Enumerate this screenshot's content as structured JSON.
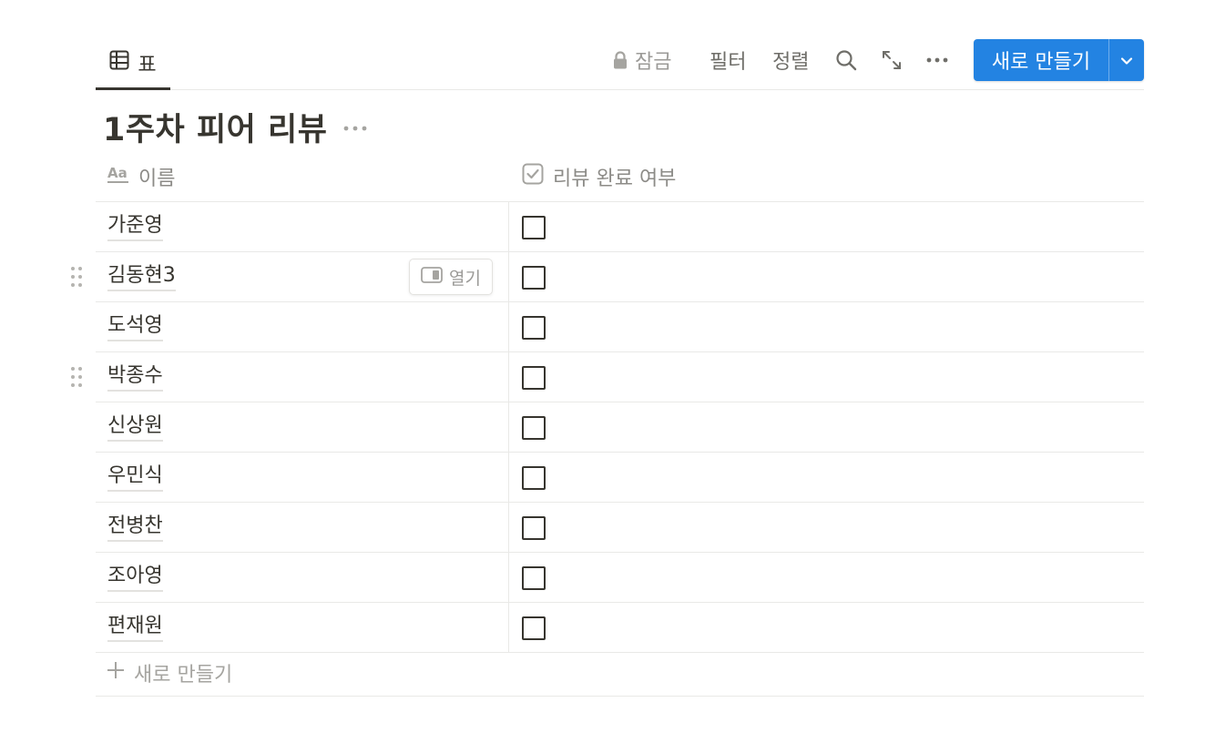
{
  "view": {
    "tab_label": "표"
  },
  "toolbar": {
    "lock_label": "잠금",
    "filter_label": "필터",
    "sort_label": "정렬",
    "new_button_label": "새로 만들기"
  },
  "database": {
    "title": "1주차 피어 리뷰"
  },
  "columns": [
    {
      "label": "이름",
      "icon": "text-property-icon"
    },
    {
      "label": "리뷰 완료 여부",
      "icon": "checkbox-property-icon"
    }
  ],
  "rows": [
    {
      "name": "가준영",
      "checked": false
    },
    {
      "name": "김동현3",
      "checked": false
    },
    {
      "name": "도석영",
      "checked": false
    },
    {
      "name": "박종수",
      "checked": false
    },
    {
      "name": "신상원",
      "checked": false
    },
    {
      "name": "우민식",
      "checked": false
    },
    {
      "name": "전병찬",
      "checked": false
    },
    {
      "name": "조아영",
      "checked": false
    },
    {
      "name": "편재원",
      "checked": false
    }
  ],
  "row_hover": {
    "open_label": "열기"
  },
  "add_row": {
    "label": "새로 만들기"
  },
  "colors": {
    "accent": "#2383e2",
    "text": "#37352f",
    "muted": "#8c8b87",
    "border": "#e9e9e7"
  }
}
